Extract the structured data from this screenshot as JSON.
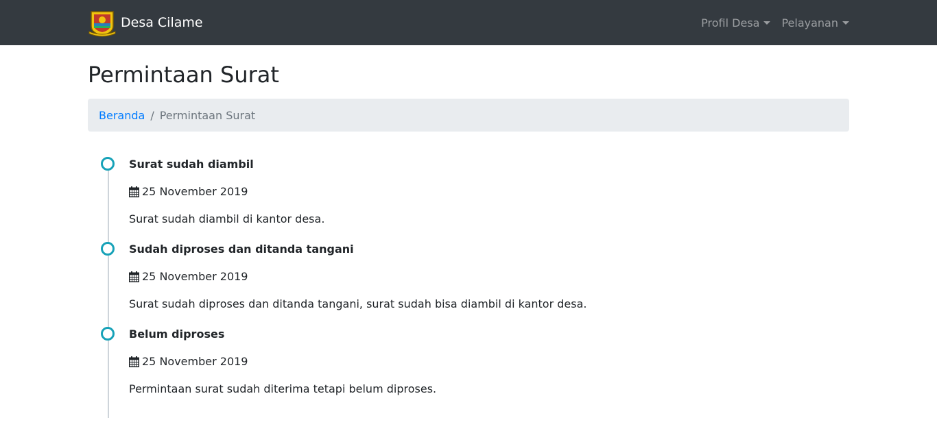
{
  "navbar": {
    "brand": "Desa Cilame",
    "menu": [
      {
        "label": "Profil Desa"
      },
      {
        "label": "Pelayanan"
      }
    ]
  },
  "page": {
    "title": "Permintaan Surat"
  },
  "breadcrumb": {
    "home": "Beranda",
    "separator": "/",
    "current": "Permintaan Surat"
  },
  "timeline": [
    {
      "title": "Surat sudah diambil",
      "date": "25 November 2019",
      "description": "Surat sudah diambil di kantor desa."
    },
    {
      "title": "Sudah diproses dan ditanda tangani",
      "date": "25 November 2019",
      "description": "Surat sudah diproses dan ditanda tangani, surat sudah bisa diambil di kantor desa."
    },
    {
      "title": "Belum diproses",
      "date": "25 November 2019",
      "description": "Permintaan surat sudah diterima tetapi belum diproses."
    }
  ],
  "colors": {
    "navbar_bg": "#343a40",
    "link": "#007bff",
    "timeline_dot": "#17a2b8"
  },
  "icons": {
    "logo": "village-emblem-icon",
    "date": "calendar-icon",
    "dropdown": "caret-down-icon"
  }
}
